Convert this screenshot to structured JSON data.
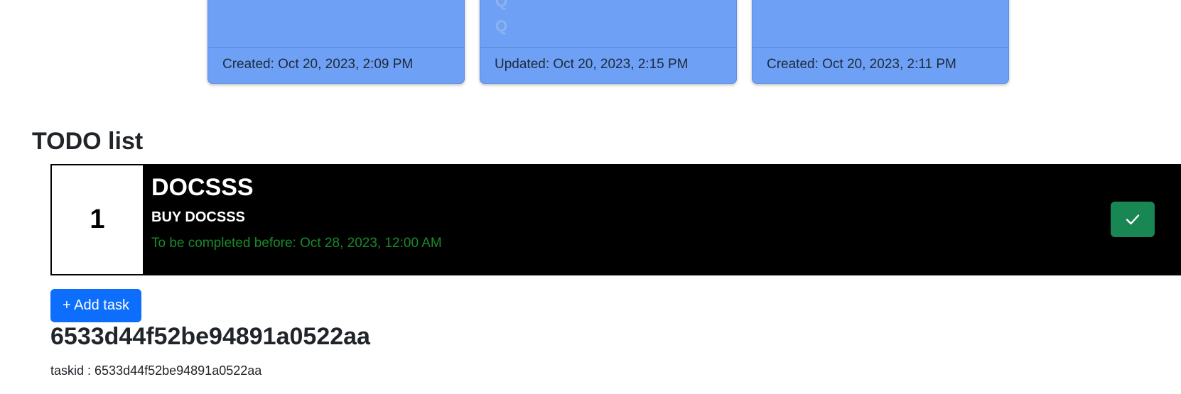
{
  "notes": [
    {
      "lines": [],
      "footer": "Created: Oct 20, 2023, 2:09 PM"
    },
    {
      "lines": [
        "Q",
        "Q"
      ],
      "footer": "Updated: Oct 20, 2023, 2:15 PM"
    },
    {
      "lines": [],
      "footer": "Created: Oct 20, 2023, 2:11 PM"
    }
  ],
  "todo": {
    "section_title": "TODO list",
    "tasks": [
      {
        "number": "1",
        "title": "DOCSSS",
        "description": "BUY DOCSSS",
        "deadline": "To be completed before: Oct 28, 2023, 12:00 AM",
        "complete_icon": "check-icon"
      }
    ],
    "add_task_label": "+ Add task"
  },
  "task_detail": {
    "heading": "6533d44f52be94891a0522aa",
    "id_line": "taskid : 6533d44f52be94891a0522aa"
  },
  "colors": {
    "note_card": "#6ea0f5",
    "task_row_bg": "#000000",
    "complete_button": "#198754",
    "deadline_text": "#198a2a",
    "primary_button": "#0d6efd"
  }
}
